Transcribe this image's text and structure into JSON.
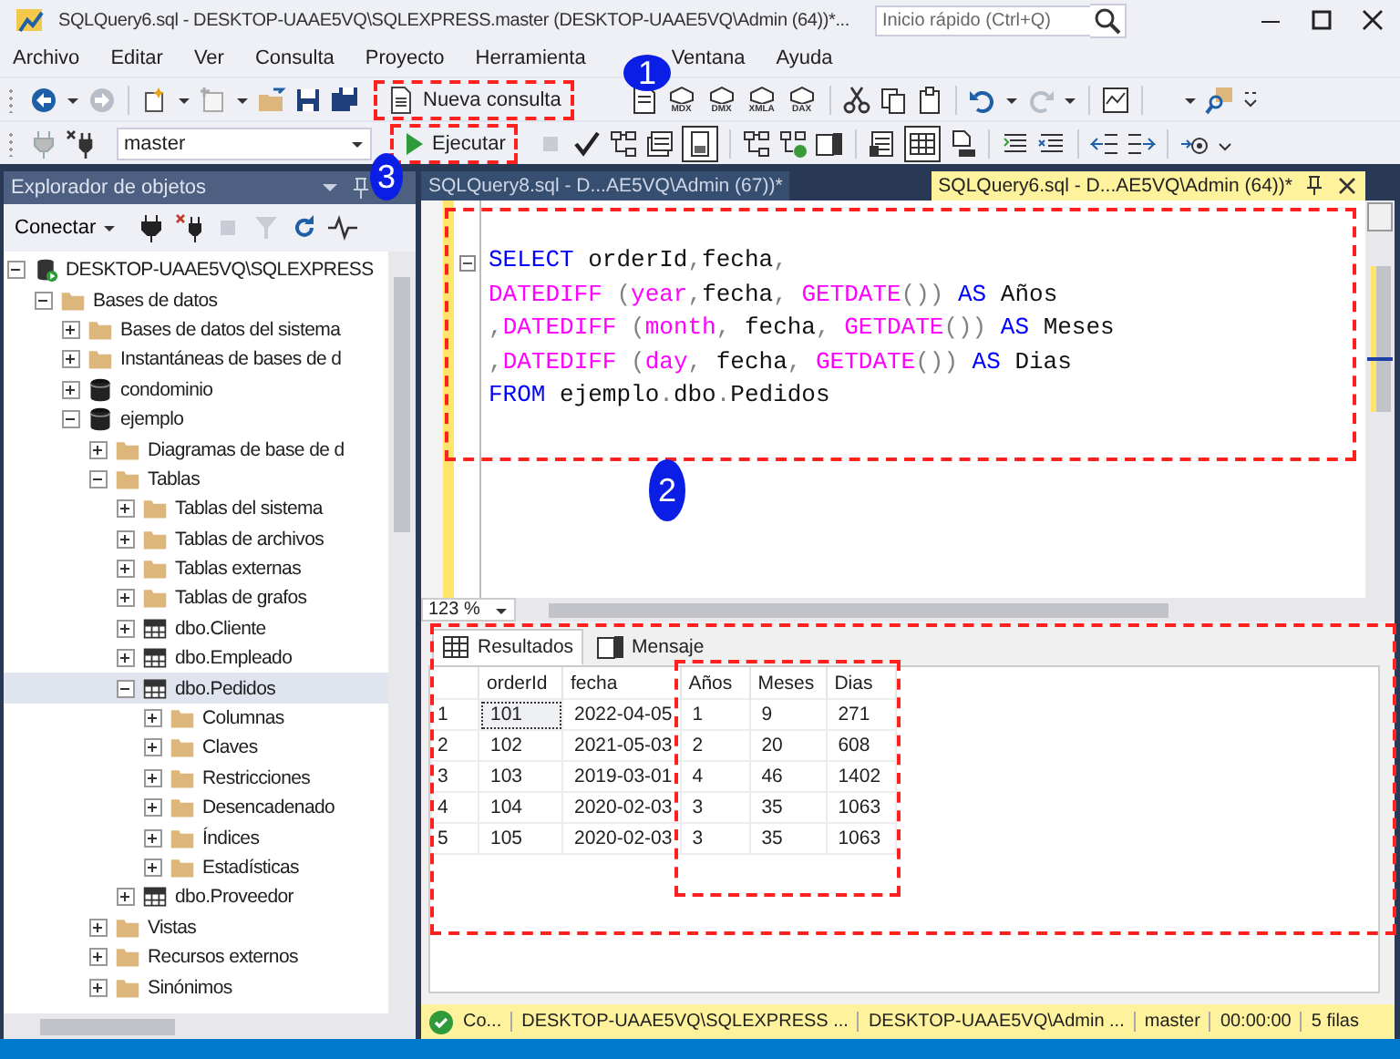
{
  "window": {
    "title": "SQLQuery6.sql - DESKTOP-UAAE5VQ\\SQLEXPRESS.master (DESKTOP-UAAE5VQ\\Admin (64))*...",
    "quick_launch": {
      "placeholder": "Inicio rápido (Ctrl+Q)"
    }
  },
  "menu": [
    "Archivo",
    "Editar",
    "Ver",
    "Consulta",
    "Proyecto",
    "Herramienta",
    "Ventana",
    "Ayuda"
  ],
  "toolbar_1": {
    "new_query_label": "Nueva consulta",
    "query_type_labels": [
      "MDX",
      "DMX",
      "XMLA",
      "DAX"
    ]
  },
  "toolbar_2": {
    "database": "master",
    "execute_label": "Ejecutar",
    "results_pane": {
      "selected": true
    },
    "results_to_grid": {
      "selected": true
    }
  },
  "object_explorer": {
    "title": "Explorador de objetos",
    "connect_label": "Conectar",
    "tree": [
      {
        "label": "DESKTOP-UAAE5VQ\\SQLEXPRESS",
        "kind": "server",
        "expanded": true,
        "selected": false,
        "children": [
          {
            "label": "Bases de datos",
            "kind": "folder",
            "expanded": true,
            "selected": false,
            "children": [
              {
                "label": "Bases de datos del sistema",
                "kind": "folder",
                "expanded": false,
                "selected": false
              },
              {
                "label": "Instantáneas de bases de d",
                "kind": "folder",
                "expanded": false,
                "selected": false
              },
              {
                "label": "condominio",
                "kind": "database",
                "expanded": false,
                "selected": false
              },
              {
                "label": "ejemplo",
                "kind": "database",
                "expanded": true,
                "selected": false,
                "children": [
                  {
                    "label": "Diagramas de base de d",
                    "kind": "folder",
                    "expanded": false,
                    "selected": false
                  },
                  {
                    "label": "Tablas",
                    "kind": "folder",
                    "expanded": true,
                    "selected": false,
                    "children": [
                      {
                        "label": "Tablas del sistema",
                        "kind": "folder",
                        "expanded": false,
                        "selected": false
                      },
                      {
                        "label": "Tablas de archivos",
                        "kind": "folder",
                        "expanded": false,
                        "selected": false
                      },
                      {
                        "label": "Tablas externas",
                        "kind": "folder",
                        "expanded": false,
                        "selected": false
                      },
                      {
                        "label": "Tablas de grafos",
                        "kind": "folder",
                        "expanded": false,
                        "selected": false
                      },
                      {
                        "label": "dbo.Cliente",
                        "kind": "table",
                        "expanded": false,
                        "selected": false
                      },
                      {
                        "label": "dbo.Empleado",
                        "kind": "table",
                        "expanded": false,
                        "selected": false
                      },
                      {
                        "label": "dbo.Pedidos",
                        "kind": "table",
                        "expanded": true,
                        "selected": true,
                        "children": [
                          {
                            "label": "Columnas",
                            "kind": "folder",
                            "expanded": false,
                            "selected": false
                          },
                          {
                            "label": "Claves",
                            "kind": "folder",
                            "expanded": false,
                            "selected": false
                          },
                          {
                            "label": "Restricciones",
                            "kind": "folder",
                            "expanded": false,
                            "selected": false
                          },
                          {
                            "label": "Desencadenado",
                            "kind": "folder",
                            "expanded": false,
                            "selected": false
                          },
                          {
                            "label": "Índices",
                            "kind": "folder",
                            "expanded": false,
                            "selected": false
                          },
                          {
                            "label": "Estadísticas",
                            "kind": "folder",
                            "expanded": false,
                            "selected": false
                          }
                        ]
                      },
                      {
                        "label": "dbo.Proveedor",
                        "kind": "table",
                        "expanded": false,
                        "selected": false
                      }
                    ]
                  },
                  {
                    "label": "Vistas",
                    "kind": "folder",
                    "expanded": false,
                    "selected": false
                  },
                  {
                    "label": "Recursos externos",
                    "kind": "folder",
                    "expanded": false,
                    "selected": false
                  },
                  {
                    "label": "Sinónimos",
                    "kind": "folder",
                    "expanded": false,
                    "selected": false
                  }
                ]
              }
            ]
          }
        ]
      }
    ]
  },
  "editor": {
    "tabs": [
      {
        "label": "SQLQuery8.sql - D...AE5VQ\\Admin (67))*",
        "selected": false
      },
      {
        "label": "SQLQuery6.sql - D...AE5VQ\\Admin (64))*",
        "selected": true
      }
    ],
    "lines": [
      [
        {
          "kind": "keyword",
          "text": "SELECT"
        },
        {
          "kind": "plain",
          "text": " orderId"
        },
        {
          "kind": "operator",
          "text": ","
        },
        {
          "kind": "plain",
          "text": "fecha"
        },
        {
          "kind": "operator",
          "text": ","
        }
      ],
      [
        {
          "kind": "function",
          "text": "DATEDIFF"
        },
        {
          "kind": "operator",
          "text": " ("
        },
        {
          "kind": "function",
          "text": "year"
        },
        {
          "kind": "operator",
          "text": ","
        },
        {
          "kind": "plain",
          "text": "fecha"
        },
        {
          "kind": "operator",
          "text": ", "
        },
        {
          "kind": "function",
          "text": "GETDATE"
        },
        {
          "kind": "operator",
          "text": "())"
        },
        {
          "kind": "keyword",
          "text": " AS"
        },
        {
          "kind": "plain",
          "text": " Años"
        }
      ],
      [
        {
          "kind": "operator",
          "text": ","
        },
        {
          "kind": "function",
          "text": "DATEDIFF"
        },
        {
          "kind": "operator",
          "text": " ("
        },
        {
          "kind": "function",
          "text": "month"
        },
        {
          "kind": "operator",
          "text": ", "
        },
        {
          "kind": "plain",
          "text": "fecha"
        },
        {
          "kind": "operator",
          "text": ", "
        },
        {
          "kind": "function",
          "text": "GETDATE"
        },
        {
          "kind": "operator",
          "text": "())"
        },
        {
          "kind": "keyword",
          "text": " AS"
        },
        {
          "kind": "plain",
          "text": " Meses"
        }
      ],
      [
        {
          "kind": "operator",
          "text": ","
        },
        {
          "kind": "function",
          "text": "DATEDIFF"
        },
        {
          "kind": "operator",
          "text": " ("
        },
        {
          "kind": "function",
          "text": "day"
        },
        {
          "kind": "operator",
          "text": ", "
        },
        {
          "kind": "plain",
          "text": "fecha"
        },
        {
          "kind": "operator",
          "text": ", "
        },
        {
          "kind": "function",
          "text": "GETDATE"
        },
        {
          "kind": "operator",
          "text": "())"
        },
        {
          "kind": "keyword",
          "text": " AS"
        },
        {
          "kind": "plain",
          "text": " Dias"
        }
      ],
      [
        {
          "kind": "keyword",
          "text": "FROM"
        },
        {
          "kind": "plain",
          "text": " ejemplo"
        },
        {
          "kind": "operator",
          "text": "."
        },
        {
          "kind": "plain",
          "text": "dbo"
        },
        {
          "kind": "operator",
          "text": "."
        },
        {
          "kind": "plain",
          "text": "Pedidos"
        }
      ]
    ],
    "zoom": "123 %"
  },
  "results": {
    "tabs": [
      {
        "label": "Resultados",
        "selected": true
      },
      {
        "label": "Mensaje",
        "selected": false
      }
    ],
    "columns": [
      "",
      "orderId",
      "fecha",
      "Años",
      "Meses",
      "Dias"
    ],
    "rows": [
      [
        "1",
        "101",
        "2022-04-05",
        "1",
        "9",
        "271"
      ],
      [
        "2",
        "102",
        "2021-05-03",
        "2",
        "20",
        "608"
      ],
      [
        "3",
        "103",
        "2019-03-01",
        "4",
        "46",
        "1402"
      ],
      [
        "4",
        "104",
        "2020-02-03",
        "3",
        "35",
        "1063"
      ],
      [
        "5",
        "105",
        "2020-02-03",
        "3",
        "35",
        "1063"
      ]
    ]
  },
  "status_bar": {
    "items": [
      "Co...",
      "DESKTOP-UAAE5VQ\\SQLEXPRESS ...",
      "DESKTOP-UAAE5VQ\\Admin ...",
      "master",
      "00:00:00",
      "5 filas"
    ]
  },
  "annotations": {
    "callouts": [
      "1",
      "2",
      "3"
    ]
  }
}
